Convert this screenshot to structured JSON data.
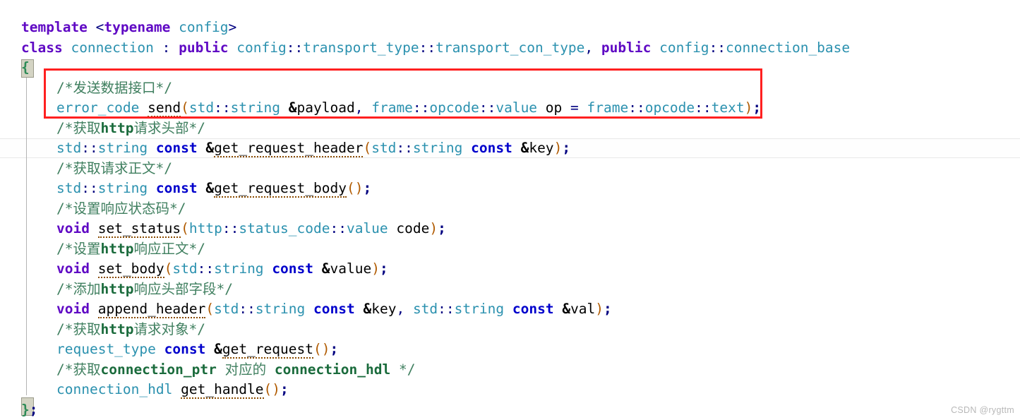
{
  "editor": {
    "language": "cpp",
    "background_color": "#ffffff",
    "font_size_px": 19.5,
    "line_height_px": 28.5,
    "current_line_number": 7,
    "colors": {
      "keyword": "#5f08c4",
      "type": "#2b91af",
      "comment": "#3f7f5f",
      "punctuation": "#b05a00",
      "operator": "#000080",
      "annotation_box": "#ff2020",
      "brace_match_bg": "#d4d4c4",
      "current_line_border": "#e8e8e8",
      "indent_guide": "#b4b4b4",
      "watermark": "#b8b8b8"
    }
  },
  "annotation": {
    "name": "red-highlight-rectangle",
    "covers_lines": [
      4,
      5
    ],
    "color": "#ff2020"
  },
  "watermark": {
    "text": "CSDN @rygttm"
  },
  "code": {
    "lines": [
      {
        "n": 1,
        "indent": 0,
        "tokens": [
          {
            "t": "template",
            "c": "kw"
          },
          {
            "t": " ",
            "c": "plain"
          },
          {
            "t": "<",
            "c": "op"
          },
          {
            "t": "typename",
            "c": "kw"
          },
          {
            "t": " ",
            "c": "plain"
          },
          {
            "t": "config",
            "c": "type"
          },
          {
            "t": ">",
            "c": "op"
          }
        ],
        "text": "template <typename config>"
      },
      {
        "n": 2,
        "indent": 0,
        "tokens": [
          {
            "t": "class",
            "c": "kw"
          },
          {
            "t": " ",
            "c": "plain"
          },
          {
            "t": "connection",
            "c": "type"
          },
          {
            "t": " : ",
            "c": "op"
          },
          {
            "t": "public",
            "c": "kw"
          },
          {
            "t": " ",
            "c": "plain"
          },
          {
            "t": "config",
            "c": "type"
          },
          {
            "t": "::",
            "c": "op"
          },
          {
            "t": "transport_type",
            "c": "type"
          },
          {
            "t": "::",
            "c": "op"
          },
          {
            "t": "transport_con_type",
            "c": "type"
          },
          {
            "t": ", ",
            "c": "op"
          },
          {
            "t": "public",
            "c": "kw"
          },
          {
            "t": " ",
            "c": "plain"
          },
          {
            "t": "config",
            "c": "type"
          },
          {
            "t": "::",
            "c": "op"
          },
          {
            "t": "connection_base",
            "c": "type"
          }
        ],
        "text": "class connection : public config::transport_type::transport_con_type, public config::connection_base"
      },
      {
        "n": 3,
        "indent": 0,
        "tokens": [
          {
            "t": "{",
            "c": "brace"
          }
        ],
        "text": "{"
      },
      {
        "n": 4,
        "indent": 1,
        "tokens": [
          {
            "t": "/*发送数据接口*/",
            "c": "cmt"
          }
        ],
        "text": "/*发送数据接口*/"
      },
      {
        "n": 5,
        "indent": 1,
        "tokens": [
          {
            "t": "error_code",
            "c": "type"
          },
          {
            "t": " ",
            "c": "plain"
          },
          {
            "t": "send",
            "c": "fn"
          },
          {
            "t": "(",
            "c": "punct"
          },
          {
            "t": "std",
            "c": "type"
          },
          {
            "t": "::",
            "c": "op"
          },
          {
            "t": "string",
            "c": "type"
          },
          {
            "t": " ",
            "c": "plain"
          },
          {
            "t": "&",
            "c": "amp"
          },
          {
            "t": "payload",
            "c": "ident"
          },
          {
            "t": ", ",
            "c": "op"
          },
          {
            "t": "frame",
            "c": "type"
          },
          {
            "t": "::",
            "c": "op"
          },
          {
            "t": "opcode",
            "c": "type"
          },
          {
            "t": "::",
            "c": "op"
          },
          {
            "t": "value",
            "c": "type"
          },
          {
            "t": " ",
            "c": "plain"
          },
          {
            "t": "op",
            "c": "ident"
          },
          {
            "t": " = ",
            "c": "op"
          },
          {
            "t": "frame",
            "c": "type"
          },
          {
            "t": "::",
            "c": "op"
          },
          {
            "t": "opcode",
            "c": "type"
          },
          {
            "t": "::",
            "c": "op"
          },
          {
            "t": "text",
            "c": "type"
          },
          {
            "t": ")",
            "c": "punct"
          },
          {
            "t": ";",
            "c": "semi"
          }
        ],
        "text": "error_code send(std::string &payload, frame::opcode::value op = frame::opcode::text);"
      },
      {
        "n": 6,
        "indent": 1,
        "tokens": [
          {
            "t": "/*获取",
            "c": "cmt"
          },
          {
            "t": "http",
            "c": "cmt-bold"
          },
          {
            "t": "请求头部*/",
            "c": "cmt"
          }
        ],
        "text": "/*获取http请求头部*/"
      },
      {
        "n": 7,
        "indent": 1,
        "highlight": true,
        "tokens": [
          {
            "t": "std",
            "c": "type"
          },
          {
            "t": "::",
            "c": "op"
          },
          {
            "t": "string",
            "c": "type"
          },
          {
            "t": " ",
            "c": "plain"
          },
          {
            "t": "const",
            "c": "blue"
          },
          {
            "t": " ",
            "c": "plain"
          },
          {
            "t": "&",
            "c": "amp"
          },
          {
            "t": "get_request_header",
            "c": "fn"
          },
          {
            "t": "(",
            "c": "punct"
          },
          {
            "t": "std",
            "c": "type"
          },
          {
            "t": "::",
            "c": "op"
          },
          {
            "t": "string",
            "c": "type"
          },
          {
            "t": " ",
            "c": "plain"
          },
          {
            "t": "const",
            "c": "blue"
          },
          {
            "t": " ",
            "c": "plain"
          },
          {
            "t": "&",
            "c": "amp"
          },
          {
            "t": "key",
            "c": "ident"
          },
          {
            "t": ")",
            "c": "punct"
          },
          {
            "t": ";",
            "c": "semi"
          }
        ],
        "text": "std::string const &get_request_header(std::string const &key);"
      },
      {
        "n": 8,
        "indent": 1,
        "tokens": [
          {
            "t": "/*获取请求正文*/",
            "c": "cmt"
          }
        ],
        "text": "/*获取请求正文*/"
      },
      {
        "n": 9,
        "indent": 1,
        "tokens": [
          {
            "t": "std",
            "c": "type"
          },
          {
            "t": "::",
            "c": "op"
          },
          {
            "t": "string",
            "c": "type"
          },
          {
            "t": " ",
            "c": "plain"
          },
          {
            "t": "const",
            "c": "blue"
          },
          {
            "t": " ",
            "c": "plain"
          },
          {
            "t": "&",
            "c": "amp"
          },
          {
            "t": "get_request_body",
            "c": "fn"
          },
          {
            "t": "()",
            "c": "punct"
          },
          {
            "t": ";",
            "c": "semi"
          }
        ],
        "text": "std::string const &get_request_body();"
      },
      {
        "n": 10,
        "indent": 1,
        "tokens": [
          {
            "t": "/*设置响应状态码*/",
            "c": "cmt"
          }
        ],
        "text": "/*设置响应状态码*/"
      },
      {
        "n": 11,
        "indent": 1,
        "tokens": [
          {
            "t": "void",
            "c": "kw"
          },
          {
            "t": " ",
            "c": "plain"
          },
          {
            "t": "set_status",
            "c": "fn"
          },
          {
            "t": "(",
            "c": "punct"
          },
          {
            "t": "http",
            "c": "type"
          },
          {
            "t": "::",
            "c": "op"
          },
          {
            "t": "status_code",
            "c": "type"
          },
          {
            "t": "::",
            "c": "op"
          },
          {
            "t": "value",
            "c": "type"
          },
          {
            "t": " ",
            "c": "plain"
          },
          {
            "t": "code",
            "c": "ident"
          },
          {
            "t": ")",
            "c": "punct"
          },
          {
            "t": ";",
            "c": "semi"
          }
        ],
        "text": "void set_status(http::status_code::value code);"
      },
      {
        "n": 12,
        "indent": 1,
        "tokens": [
          {
            "t": "/*设置",
            "c": "cmt"
          },
          {
            "t": "http",
            "c": "cmt-bold"
          },
          {
            "t": "响应正文*/",
            "c": "cmt"
          }
        ],
        "text": "/*设置http响应正文*/"
      },
      {
        "n": 13,
        "indent": 1,
        "tokens": [
          {
            "t": "void",
            "c": "kw"
          },
          {
            "t": " ",
            "c": "plain"
          },
          {
            "t": "set_body",
            "c": "fn"
          },
          {
            "t": "(",
            "c": "punct"
          },
          {
            "t": "std",
            "c": "type"
          },
          {
            "t": "::",
            "c": "op"
          },
          {
            "t": "string",
            "c": "type"
          },
          {
            "t": " ",
            "c": "plain"
          },
          {
            "t": "const",
            "c": "blue"
          },
          {
            "t": " ",
            "c": "plain"
          },
          {
            "t": "&",
            "c": "amp"
          },
          {
            "t": "value",
            "c": "ident"
          },
          {
            "t": ")",
            "c": "punct"
          },
          {
            "t": ";",
            "c": "semi"
          }
        ],
        "text": "void set_body(std::string const &value);"
      },
      {
        "n": 14,
        "indent": 1,
        "tokens": [
          {
            "t": "/*添加",
            "c": "cmt"
          },
          {
            "t": "http",
            "c": "cmt-bold"
          },
          {
            "t": "响应头部字段*/",
            "c": "cmt"
          }
        ],
        "text": "/*添加http响应头部字段*/"
      },
      {
        "n": 15,
        "indent": 1,
        "tokens": [
          {
            "t": "void",
            "c": "kw"
          },
          {
            "t": " ",
            "c": "plain"
          },
          {
            "t": "append_header",
            "c": "fn"
          },
          {
            "t": "(",
            "c": "punct"
          },
          {
            "t": "std",
            "c": "type"
          },
          {
            "t": "::",
            "c": "op"
          },
          {
            "t": "string",
            "c": "type"
          },
          {
            "t": " ",
            "c": "plain"
          },
          {
            "t": "const",
            "c": "blue"
          },
          {
            "t": " ",
            "c": "plain"
          },
          {
            "t": "&",
            "c": "amp"
          },
          {
            "t": "key",
            "c": "ident"
          },
          {
            "t": ", ",
            "c": "op"
          },
          {
            "t": "std",
            "c": "type"
          },
          {
            "t": "::",
            "c": "op"
          },
          {
            "t": "string",
            "c": "type"
          },
          {
            "t": " ",
            "c": "plain"
          },
          {
            "t": "const",
            "c": "blue"
          },
          {
            "t": " ",
            "c": "plain"
          },
          {
            "t": "&",
            "c": "amp"
          },
          {
            "t": "val",
            "c": "ident"
          },
          {
            "t": ")",
            "c": "punct"
          },
          {
            "t": ";",
            "c": "semi"
          }
        ],
        "text": "void append_header(std::string const &key, std::string const &val);"
      },
      {
        "n": 16,
        "indent": 1,
        "tokens": [
          {
            "t": "/*获取",
            "c": "cmt"
          },
          {
            "t": "http",
            "c": "cmt-bold"
          },
          {
            "t": "请求对象*/",
            "c": "cmt"
          }
        ],
        "text": "/*获取http请求对象*/"
      },
      {
        "n": 17,
        "indent": 1,
        "tokens": [
          {
            "t": "request_type",
            "c": "type"
          },
          {
            "t": " ",
            "c": "plain"
          },
          {
            "t": "const",
            "c": "blue"
          },
          {
            "t": " ",
            "c": "plain"
          },
          {
            "t": "&",
            "c": "amp"
          },
          {
            "t": "get_request",
            "c": "fn"
          },
          {
            "t": "()",
            "c": "punct"
          },
          {
            "t": ";",
            "c": "semi"
          }
        ],
        "text": "request_type const &get_request();"
      },
      {
        "n": 18,
        "indent": 1,
        "tokens": [
          {
            "t": "/*获取",
            "c": "cmt"
          },
          {
            "t": "connection_ptr",
            "c": "cmt-bold"
          },
          {
            "t": " 对应的 ",
            "c": "cmt"
          },
          {
            "t": "connection_hdl",
            "c": "cmt-bold"
          },
          {
            "t": " */",
            "c": "cmt"
          }
        ],
        "text": "/*获取connection_ptr 对应的 connection_hdl */"
      },
      {
        "n": 19,
        "indent": 1,
        "tokens": [
          {
            "t": "connection_hdl",
            "c": "type"
          },
          {
            "t": " ",
            "c": "plain"
          },
          {
            "t": "get_handle",
            "c": "fn"
          },
          {
            "t": "()",
            "c": "punct"
          },
          {
            "t": ";",
            "c": "semi"
          }
        ],
        "text": "connection_hdl get_handle();"
      },
      {
        "n": 20,
        "indent": 0,
        "tokens": [
          {
            "t": "}",
            "c": "brace"
          },
          {
            "t": ";",
            "c": "semi"
          }
        ],
        "text": "};"
      }
    ]
  }
}
